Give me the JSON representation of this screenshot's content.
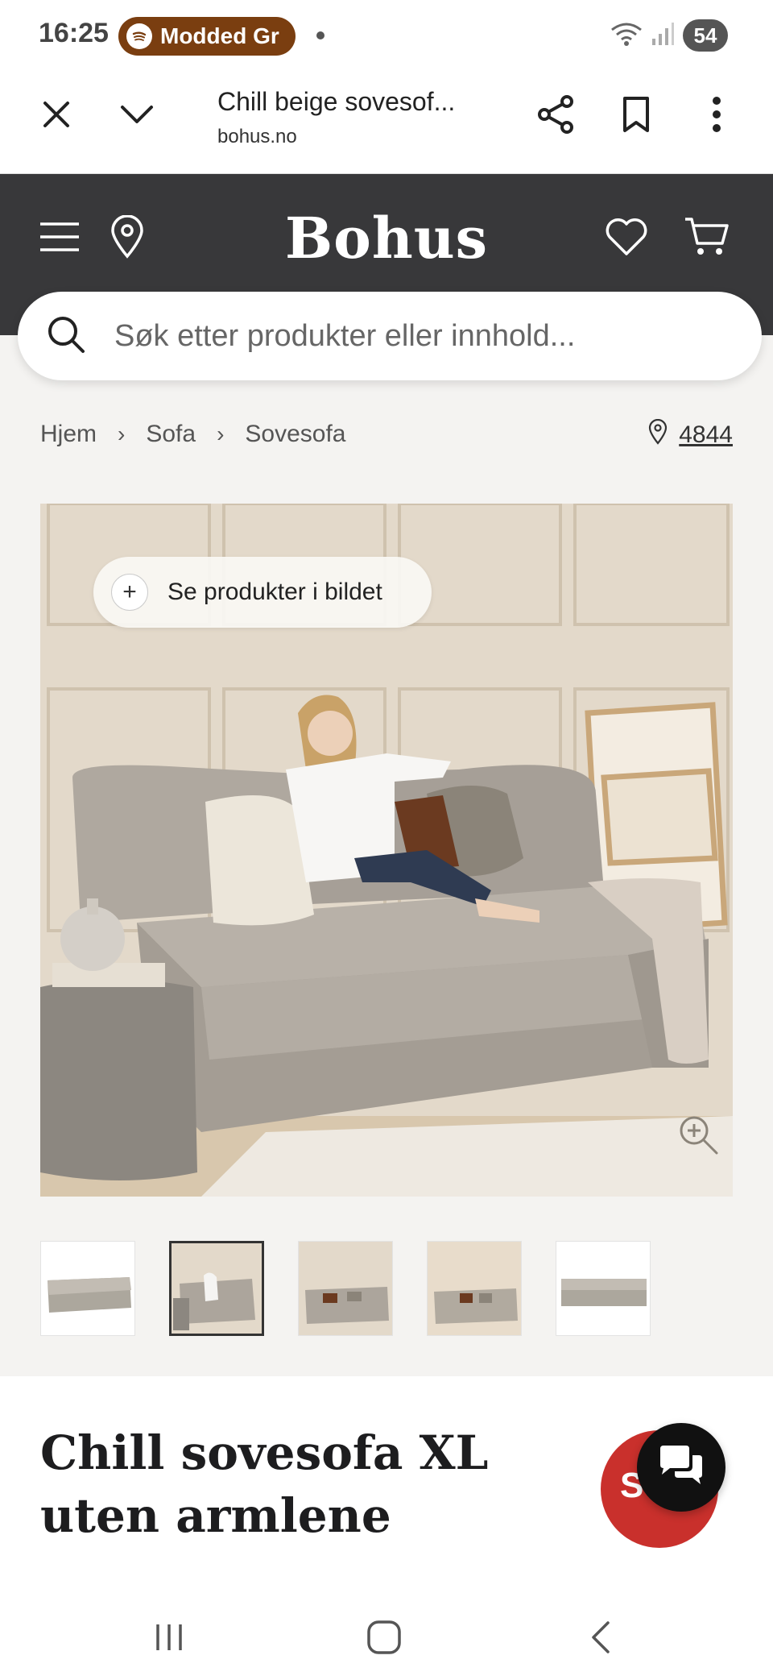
{
  "status_bar": {
    "time": "16:25",
    "media_label": "Modded Gr",
    "battery": "54",
    "icons": [
      "wifi-icon",
      "signal-icon"
    ]
  },
  "browser": {
    "page_title": "Chill beige sovesof...",
    "domain": "bohus.no",
    "icons": [
      "close-icon",
      "chevron-down-icon",
      "share-icon",
      "bookmark-icon",
      "more-icon"
    ]
  },
  "header": {
    "logo": "Bohus",
    "icons": [
      "menu-icon",
      "location-pin-icon",
      "heart-icon",
      "cart-icon"
    ],
    "background": "#38383a"
  },
  "search": {
    "placeholder": "Søk etter produkter eller innhold..."
  },
  "breadcrumb": {
    "items": [
      "Hjem",
      "Sofa",
      "Sovesofa"
    ],
    "store_code": "4844"
  },
  "hero": {
    "see_products_label": "Se produkter i bildet",
    "zoom_icon": "zoom-in-icon"
  },
  "thumbnails": {
    "count": 5,
    "active_index": 1
  },
  "product": {
    "title": "Chill sovesofa XL uten armlene",
    "sale_badge_text": "S",
    "sale_color": "#c9302c"
  },
  "navbar": {
    "icons": [
      "recents-icon",
      "home-icon",
      "back-icon"
    ]
  }
}
